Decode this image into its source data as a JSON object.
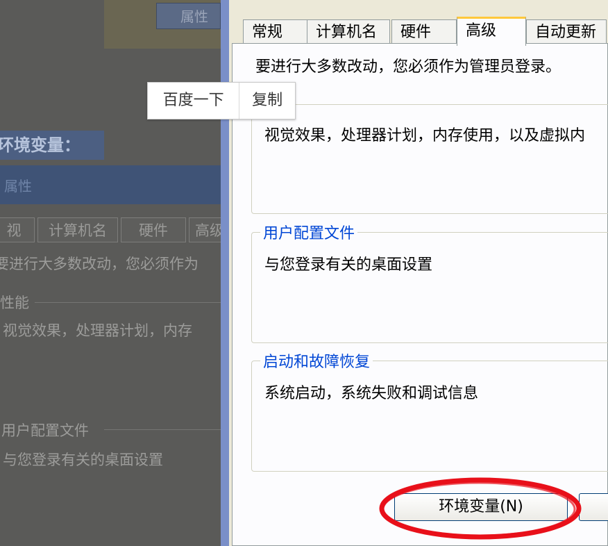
{
  "background": {
    "properties_button": "属性",
    "env_label": "环境变量：",
    "titlebar": "属性",
    "tabs": [
      "视",
      "计算机名",
      "硬件",
      "高级"
    ],
    "notice": "要进行大多数改动，您必须作为",
    "performance_label": "性能",
    "performance_desc": "视觉效果，处理器计划，内存",
    "profile_label": "用户配置文件",
    "profile_desc": "与您登录有关的桌面设置"
  },
  "dialog": {
    "tabs": [
      "常规",
      "计算机名",
      "硬件",
      "高级",
      "自动更新"
    ],
    "active_tab": "高级",
    "notice": "要进行大多数改动，您必须作为管理员登录。",
    "groups": [
      {
        "label": "",
        "desc": "视觉效果，处理器计划，内存使用，以及虚拟内"
      },
      {
        "label": "用户配置文件",
        "desc": "与您登录有关的桌面设置"
      },
      {
        "label": "启动和故障恢复",
        "desc": "系统启动，系统失败和调试信息"
      }
    ],
    "env_button": "环境变量(N)"
  },
  "popup": {
    "search_label": "百度一下",
    "copy_label": "复制"
  },
  "colors": {
    "highlight_ellipse": "#e8101a",
    "active_tab_accent": "#ffc83c",
    "group_label": "#0046d5"
  }
}
